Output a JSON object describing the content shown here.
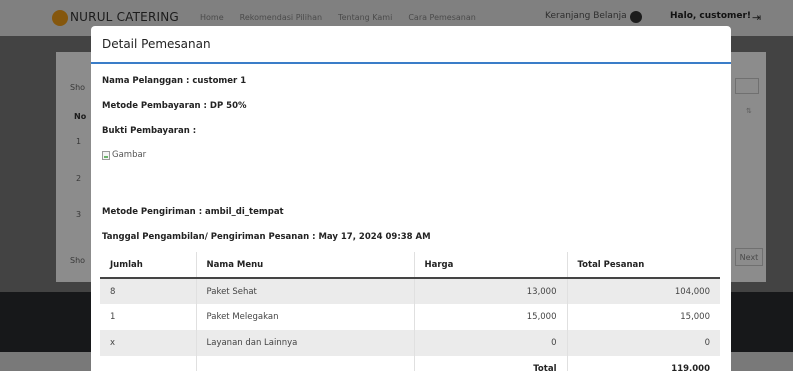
{
  "background": {
    "brand": "NURUL CATERING",
    "nav_links": [
      "Home",
      "Rekomendasi Pilihan",
      "Tentang Kami",
      "Cara Pemesanan"
    ],
    "cart": "Keranjang Belanja",
    "greeting": "Halo, customer!",
    "logout_icon": "logout-icon",
    "table": {
      "show_top": "Sho",
      "col_no": "No",
      "row_numbers": [
        "1",
        "2",
        "3"
      ],
      "show_bottom": "Sho",
      "next": "Next"
    }
  },
  "modal": {
    "title": "Detail Pemesanan",
    "customer_line": "Nama Pelanggan : customer 1",
    "payment_line": "Metode Pembayaran : DP 50%",
    "proof_label": "Bukti Pembayaran :",
    "proof_image_alt": "Gambar",
    "shipping_line": "Metode Pengiriman : ambil_di_tempat",
    "date_line": "Tanggal Pengambilan/ Pengiriman Pesanan : May 17, 2024 09:38 AM",
    "table": {
      "headers": [
        "Jumlah",
        "Nama Menu",
        "Harga",
        "Total Pesanan"
      ],
      "rows": [
        {
          "qty": "8",
          "menu": "Paket Sehat",
          "price": "13,000",
          "total": "104,000"
        },
        {
          "qty": "1",
          "menu": "Paket Melegakan",
          "price": "15,000",
          "total": "15,000"
        },
        {
          "qty": "x",
          "menu": "Layanan dan Lainnya",
          "price": "0",
          "total": "0"
        }
      ],
      "total_label": "Total",
      "total_value": "119,000"
    }
  }
}
